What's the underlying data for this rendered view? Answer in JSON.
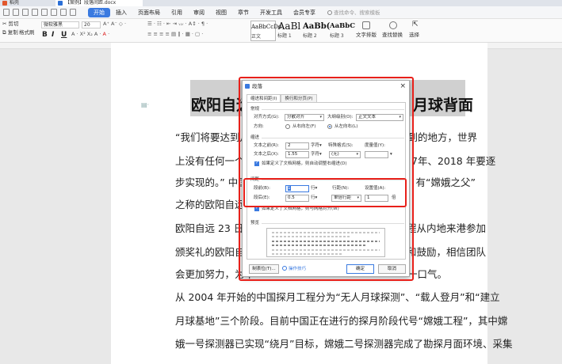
{
  "tabs": [
    {
      "label": "稻壳"
    },
    {
      "label": "【案例】段落间距.docx"
    }
  ],
  "menu": {
    "items": [
      "开始",
      "插入",
      "页面布局",
      "引用",
      "审阅",
      "视图",
      "章节",
      "开发工具",
      "会员专享"
    ],
    "active": "开始",
    "search_placeholder": "查找命令、搜索模板"
  },
  "ribbon": {
    "cut": "剪切",
    "copy": "复制",
    "format_painter": "格式刷",
    "font_name": "微软雅黑",
    "font_size": "20",
    "bold": "B",
    "italic": "I",
    "underline": "U",
    "styles": [
      {
        "preview": "AaBbCcDd",
        "label": "正文"
      },
      {
        "preview": "AaBl",
        "label": "标题 1"
      },
      {
        "preview": "AaBb(",
        "label": "标题 2"
      },
      {
        "preview": "AaBbC",
        "label": "标题 3"
      }
    ],
    "text_layout": "文字排版",
    "find_replace": "查找替换",
    "select": "选择"
  },
  "document": {
    "title_left": "欧阳自远",
    "title_right": "月球背面",
    "lines": [
      "“我们将要达到月",
      "不到的地方，世界",
      "上没有任何一个国",
      "7年、2018 年要逐",
      "步实现的。” 中国",
      "、有“嫦娥之父”",
      "之称的欧阳自远对",
      "欧阳自远 23 日在",
      "程从内地来港参加",
      "颁奖礼的欧阳自远",
      "和鼓励，相信团队",
      "会更加努力，为中",
      "一口气。",
      "从 2004 年开始的中国探月工程分为“无人月球探测”、“载人登月”和“建立",
      "月球基地”三个阶段。目前中国正在进行的探月阶段代号“嫦娥工程”，其中嫦",
      "娥一号探测器已实现“绕月”目标，嫦娥二号探测器完成了勘探月面环境、采集"
    ]
  },
  "dialog": {
    "title": "段落",
    "tabs": [
      "缩进和间距(I)",
      "换行和分页(P)"
    ],
    "active_tab": "缩进和间距(I)",
    "general": {
      "heading": "常规",
      "alignment_label": "对齐方式(G):",
      "alignment_value": "分散对齐",
      "outline_label": "大纲级别(O):",
      "outline_value": "正文文本",
      "direction_label": "方向:",
      "rtl": "从右向左(F)",
      "ltr": "从左向右(L)"
    },
    "indent": {
      "heading": "缩进",
      "before_label": "文本之前(R):",
      "before_value": "2",
      "before_unit": "字符▾",
      "after_label": "文本之后(X):",
      "after_value": "1.55",
      "after_unit": "字符▾",
      "special_label": "特殊格式(S):",
      "special_value": "(无)",
      "measure_label": "度量值(Y):",
      "measure_value": "",
      "grid_check": "如果定义了文档网格，则自动调整右缩进(D)"
    },
    "spacing": {
      "heading": "间距",
      "before_label": "段前(B):",
      "before_value": "1",
      "before_unit": "行▾",
      "after_label": "段后(E):",
      "after_value": "0.5",
      "after_unit": "行▾",
      "line_label": "行距(N):",
      "line_value": "单倍行距",
      "setvalue_label": "设置值(A):",
      "setvalue_value": "1",
      "setvalue_unit": "倍",
      "grid_check": "如果定义了文档网格，则与网格对齐(W)"
    },
    "preview_heading": "预览",
    "tabs_button": "制表位(T)...",
    "tips": "操作技巧",
    "ok": "确定",
    "cancel": "取消"
  }
}
